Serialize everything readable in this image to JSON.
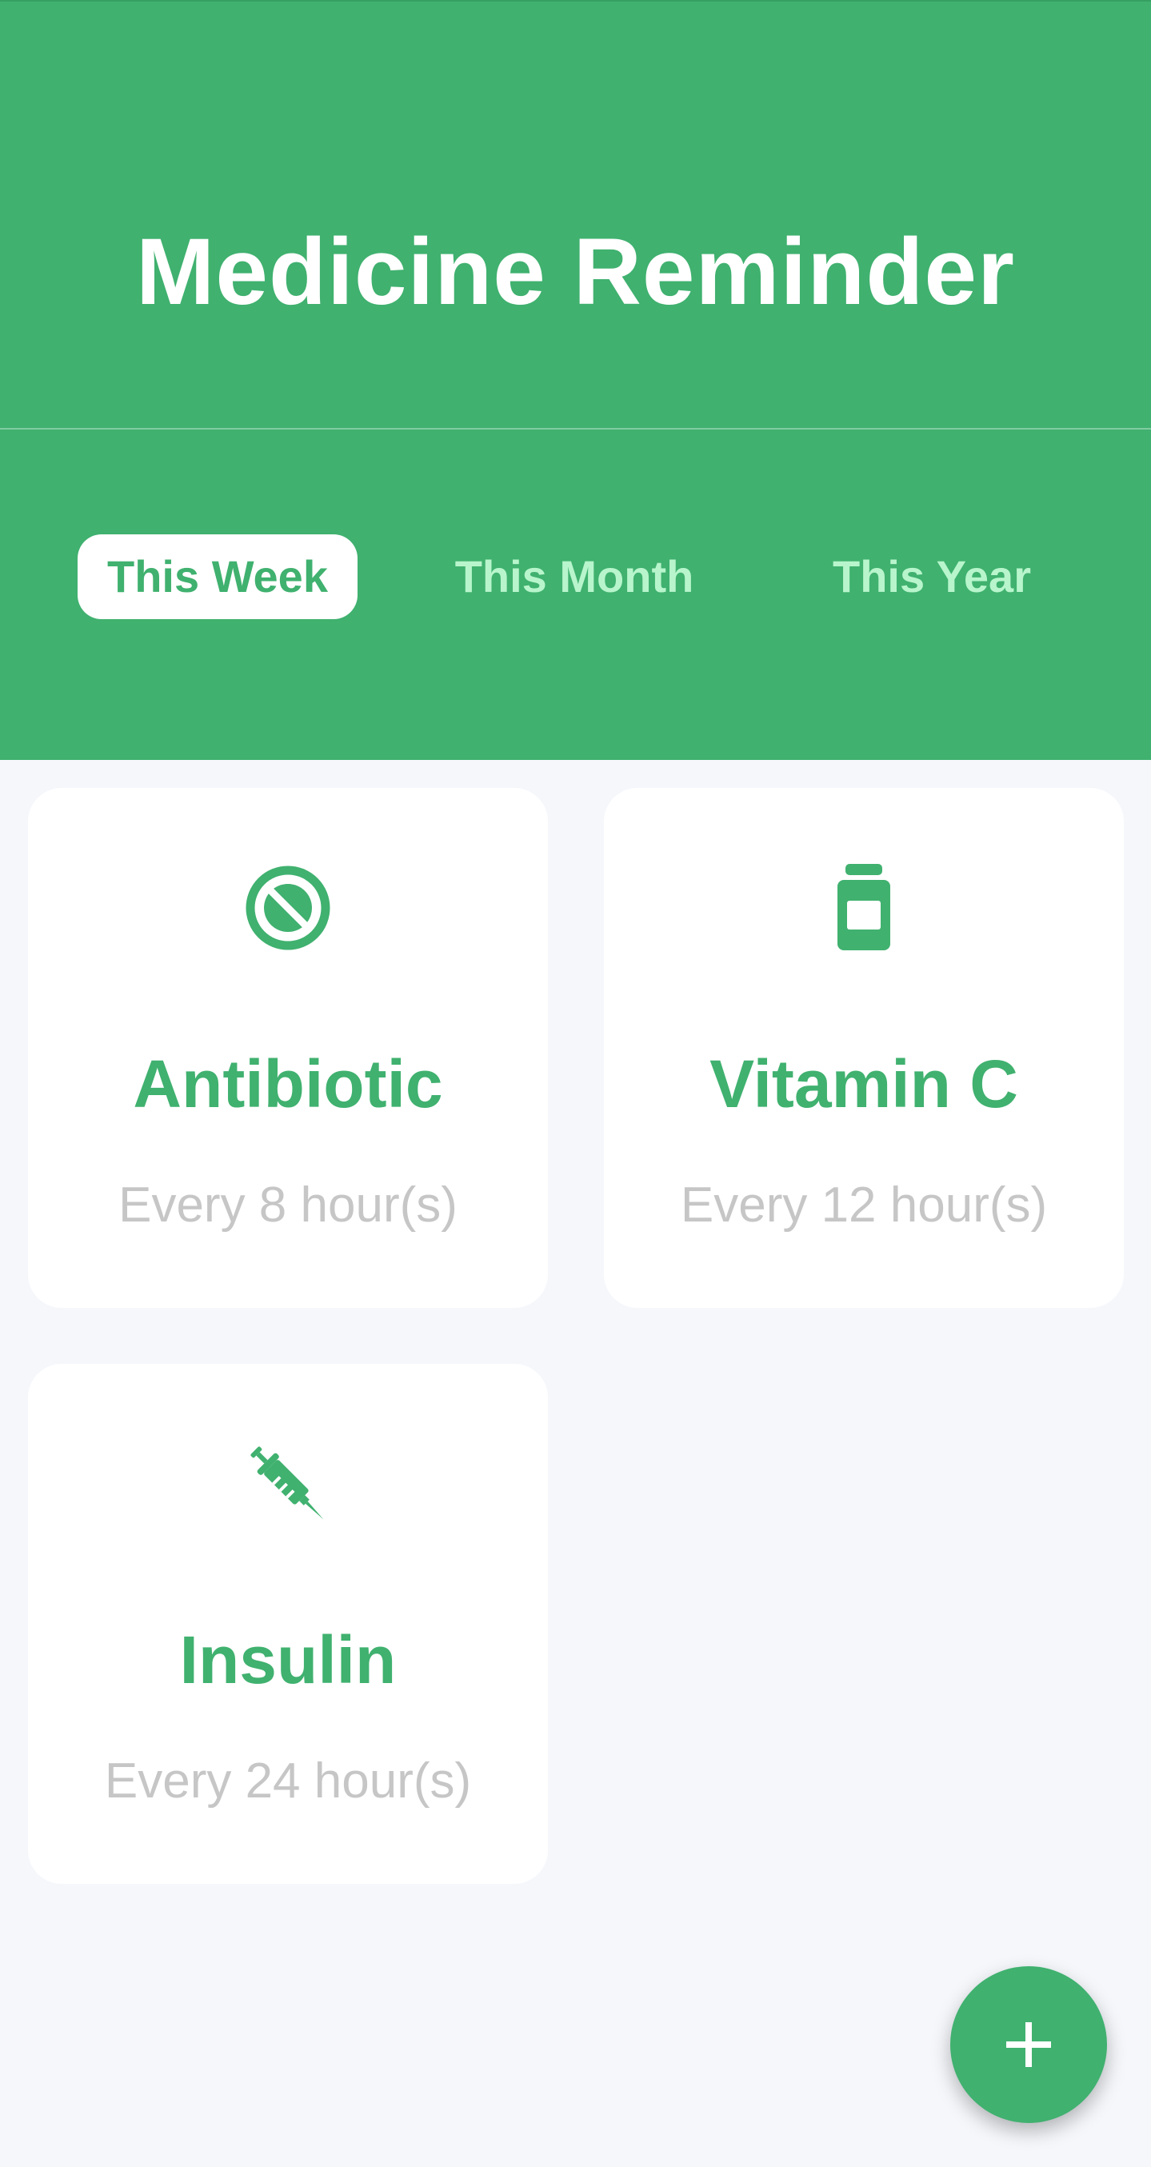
{
  "app": {
    "title": "Medicine Reminder"
  },
  "tabs": [
    {
      "label": "This Week",
      "active": true
    },
    {
      "label": "This Month",
      "active": false
    },
    {
      "label": "This Year",
      "active": false
    }
  ],
  "medicines": [
    {
      "name": "Antibiotic",
      "frequency": "Every 8 hour(s)",
      "icon": "tablet-icon"
    },
    {
      "name": "Vitamin C",
      "frequency": "Every 12 hour(s)",
      "icon": "pill-bottle-icon"
    },
    {
      "name": "Insulin",
      "frequency": "Every 24 hour(s)",
      "icon": "syringe-icon"
    }
  ],
  "fab": {
    "icon": "plus-icon"
  },
  "colors": {
    "primary": "#40B16F",
    "tab_inactive_text": "#B8F5CC",
    "background": "#F5F7FB",
    "muted_text": "#C6C6C6"
  }
}
